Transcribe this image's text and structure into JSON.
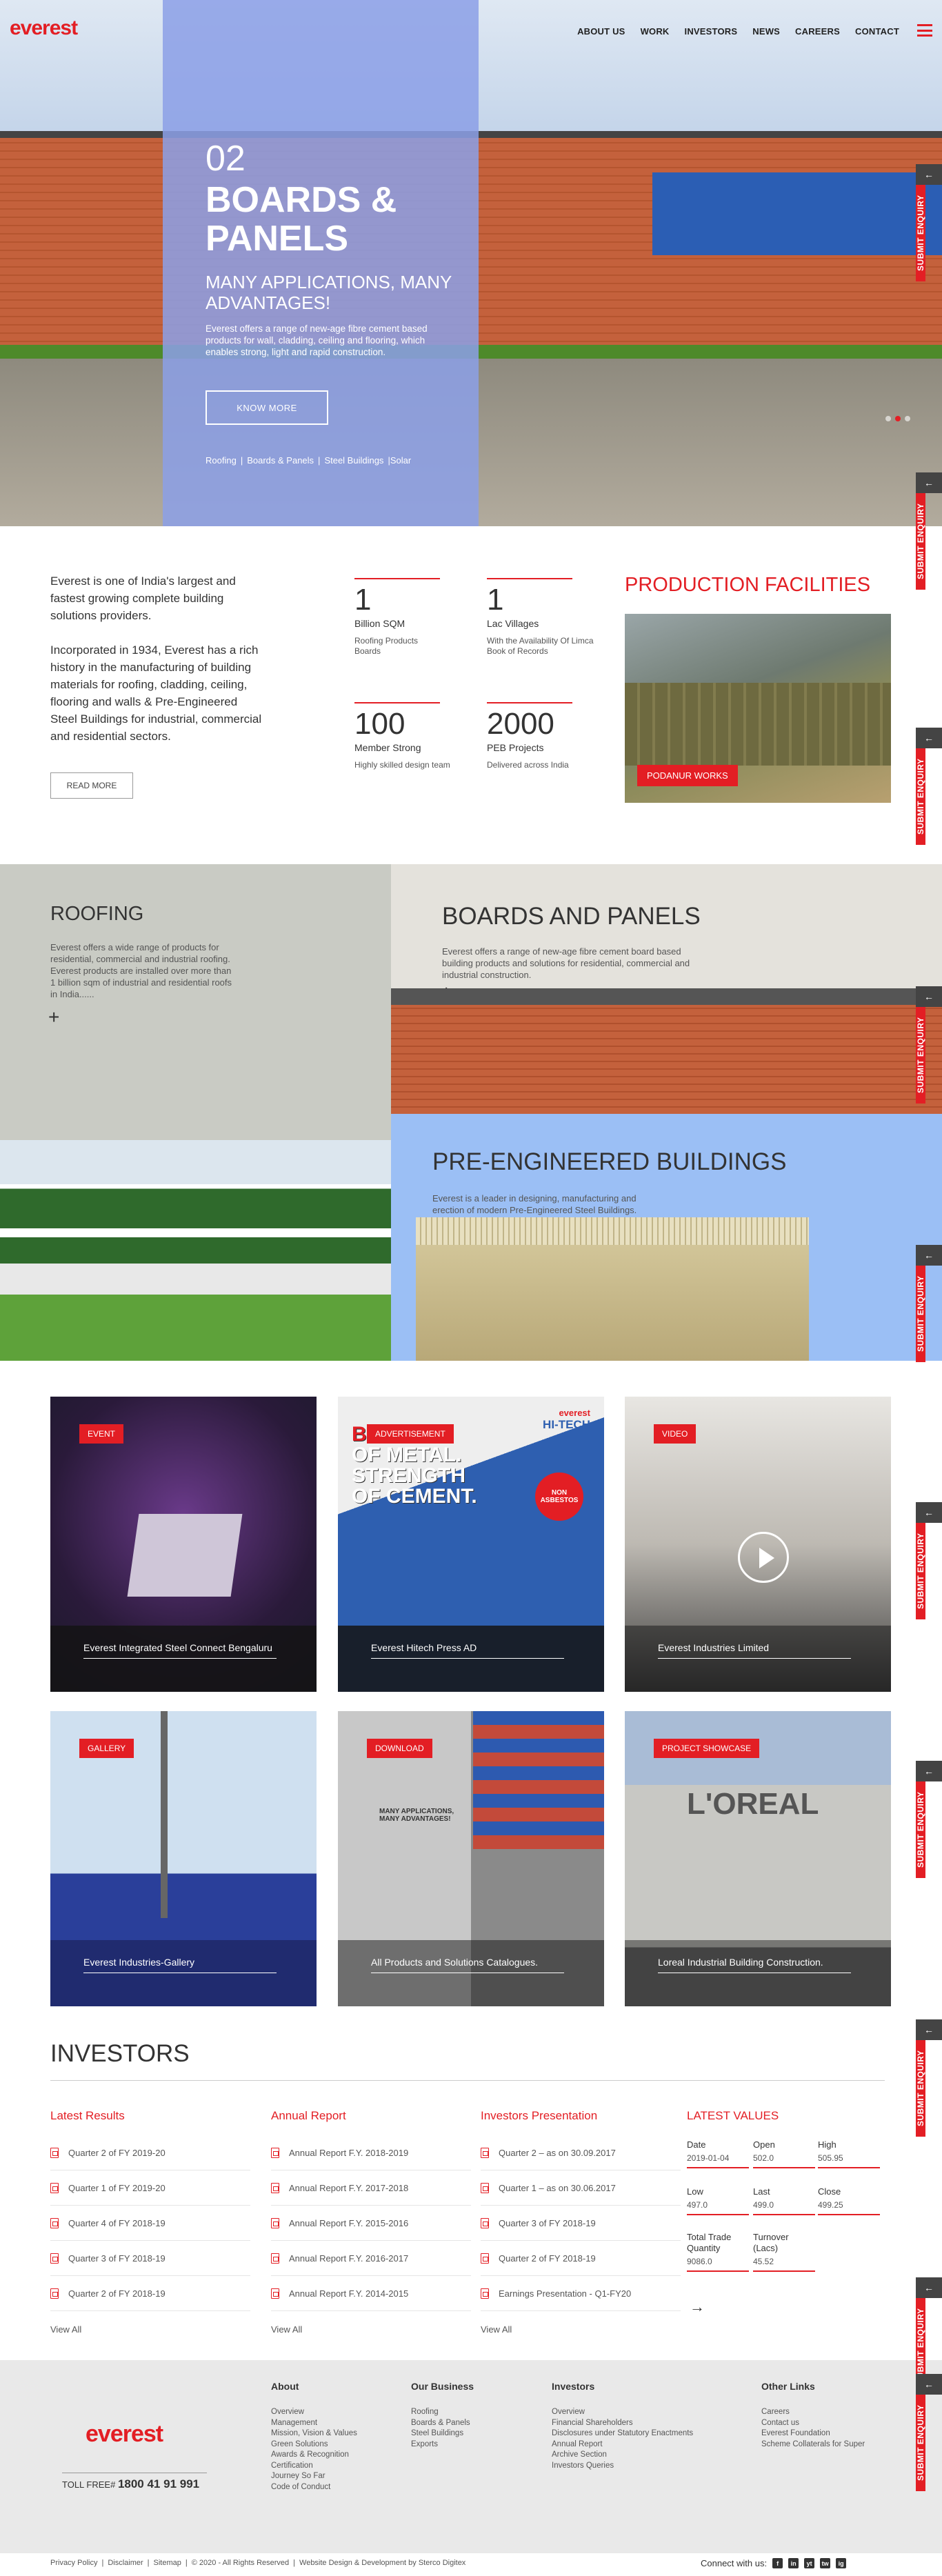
{
  "header": {
    "logo": "everest",
    "nav": [
      "ABOUT US",
      "WORK",
      "INVESTORS",
      "NEWS",
      "CAREERS",
      "CONTACT"
    ]
  },
  "hero": {
    "number": "02",
    "title": "BOARDS & PANELS",
    "subtitle": "MANY APPLICATIONS, MANY ADVANTAGES!",
    "description": "Everest offers a range of new-age fibre cement based products for wall, cladding, ceiling and flooring, which enables strong, light and rapid construction.",
    "button": "KNOW MORE",
    "links": [
      "Roofing",
      "|",
      "Boards & Panels",
      "|",
      "Steel Buildings",
      "|Solar"
    ],
    "slides": 3,
    "active_slide": 1
  },
  "side_tab_label": "SUBMIT ENQUIRY",
  "side_tab_arrow": "←",
  "about": {
    "para1": "Everest is one of India's largest and fastest growing complete building solutions providers.",
    "para2": "Incorporated in 1934, Everest has a rich history in the manufacturing of building materials for roofing, cladding, ceiling, flooring and walls & Pre-Engineered Steel Buildings for industrial, commercial and residential sectors.",
    "read_more": "READ MORE",
    "stats": [
      {
        "num": "1",
        "unit": "Billion SQM",
        "detail": "Roofing Products Boards"
      },
      {
        "num": "1",
        "unit": "Lac Villages",
        "detail": "With the Availability Of Limca Book of Records"
      },
      {
        "num": "100",
        "unit": "Member Strong",
        "detail": "Highly skilled design team"
      },
      {
        "num": "2000",
        "unit": "PEB Projects",
        "detail": "Delivered across India"
      }
    ],
    "production_title": "PRODUCTION FACILITIES",
    "production_tag": "PODANUR WORKS"
  },
  "business": {
    "roofing": {
      "title": "ROOFING",
      "desc": "Everest offers a wide range of products for residential, commercial and industrial roofing. Everest products are installed over more than 1 billion sqm of industrial and residential roofs in India......"
    },
    "boards": {
      "title": "BOARDS AND PANELS",
      "desc": "Everest offers a range of new-age fibre cement board based building products and solutions for residential, commercial and industrial construction."
    },
    "peb": {
      "title": "PRE-ENGINEERED BUILDINGS",
      "desc": "Everest is a leader in designing, manufacturing and erection of modern Pre-Engineered Steel Buildings."
    },
    "plus": "+"
  },
  "media": [
    {
      "tag": "EVENT",
      "caption": "Everest Integrated Steel Connect Bengaluru"
    },
    {
      "tag": "ADVERTISEMENT",
      "caption": "Everest Hitech Press AD"
    },
    {
      "tag": "VIDEO",
      "caption": "Everest Industries Limited"
    },
    {
      "tag": "GALLERY",
      "caption": "Everest Industries-Gallery"
    },
    {
      "tag": "DOWNLOAD",
      "caption": "All Products and Solutions Catalogues."
    },
    {
      "tag": "PROJECT SHOWCASE",
      "caption": "Loreal Industrial Building Construction."
    }
  ],
  "ad_text": {
    "brand": "everest",
    "line": "HI-TECH",
    "big1": "BEAUTY",
    "big2": "OF METAL.",
    "big3": "STRENGTH",
    "big4": "OF CEMENT.",
    "badge": "NON ASBESTOS"
  },
  "catalogue_text": "MANY APPLICATIONS, MANY ADVANTAGES!",
  "loreal_sign": "L'OREAL",
  "investors": {
    "title": "INVESTORS",
    "latest_results": {
      "title": "Latest Results",
      "items": [
        "Quarter 2 of FY 2019-20",
        "Quarter 1 of FY 2019-20",
        "Quarter 4 of FY 2018-19",
        "Quarter 3 of FY 2018-19",
        "Quarter 2 of FY 2018-19"
      ]
    },
    "annual_report": {
      "title": "Annual Report",
      "items": [
        "Annual Report F.Y. 2018-2019",
        "Annual Report F.Y. 2017-2018",
        "Annual Report F.Y. 2015-2016",
        "Annual Report F.Y. 2016-2017",
        "Annual Report F.Y. 2014-2015"
      ]
    },
    "presentation": {
      "title": "Investors Presentation",
      "items": [
        "Quarter 2 – as on 30.09.2017",
        "Quarter 1 – as on 30.06.2017",
        "Quarter 3 of FY 2018-19",
        "Quarter 2 of FY 2018-19",
        "Earnings Presentation - Q1-FY20"
      ]
    },
    "view_all": "View All",
    "latest_values": {
      "title": "LATEST VALUES",
      "date_k": "Date",
      "date_v": "2019-01-04",
      "open_k": "Open",
      "open_v": "502.0",
      "high_k": "High",
      "high_v": "505.95",
      "low_k": "Low",
      "low_v": "497.0",
      "last_k": "Last",
      "last_v": "499.0",
      "close_k": "Close",
      "close_v": "499.25",
      "ttq_k": "Total Trade Quantity",
      "ttq_v": "9086.0",
      "turn_k": "Turnover (Lacs)",
      "turn_v": "45.52"
    },
    "arrow": "→"
  },
  "footer": {
    "logo": "everest",
    "toll_label": "TOLL FREE#",
    "toll_number": "1800 41 91 991",
    "about": {
      "title": "About",
      "links": [
        "Overview",
        "Management",
        "Mission, Vision & Values",
        "Green Solutions",
        "Awards & Recognition",
        "Certification",
        "Journey So Far",
        "Code of Conduct"
      ]
    },
    "business": {
      "title": "Our Business",
      "links": [
        "Roofing",
        "Boards & Panels",
        "Steel Buildings",
        "Exports"
      ]
    },
    "investors": {
      "title": "Investors",
      "links": [
        "Overview",
        "Financial Shareholders",
        "Disclosures under Statutory Enactments",
        "Annual Report",
        "Archive Section",
        "Investors Queries"
      ]
    },
    "other": {
      "title": "Other Links",
      "links": [
        "Careers",
        "Contact us",
        "Everest Foundation",
        "Scheme Collaterals for Super"
      ]
    },
    "legal": [
      "Privacy Policy",
      "|",
      "Disclaimer",
      "|",
      "Sitemap",
      "|",
      "© 2020 - All Rights Reserved",
      "|",
      "Website Design & Development by Sterco Digitex"
    ],
    "connect": "Connect with us:",
    "social": [
      "f",
      "in",
      "yt",
      "tw",
      "ig"
    ]
  }
}
